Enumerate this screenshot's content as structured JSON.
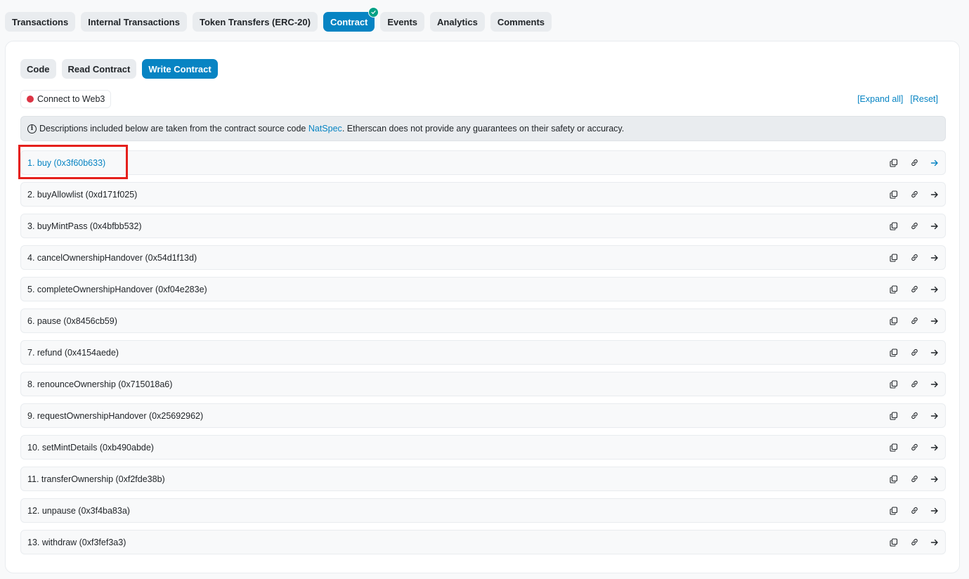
{
  "tabs": [
    {
      "label": "Transactions"
    },
    {
      "label": "Internal Transactions"
    },
    {
      "label": "Token Transfers (ERC-20)"
    },
    {
      "label": "Contract"
    },
    {
      "label": "Events"
    },
    {
      "label": "Analytics"
    },
    {
      "label": "Comments"
    }
  ],
  "subtabs": [
    {
      "label": "Code"
    },
    {
      "label": "Read Contract"
    },
    {
      "label": "Write Contract"
    }
  ],
  "connect": {
    "label": "Connect to Web3"
  },
  "links": {
    "expand_all": "[Expand all]",
    "reset": "[Reset]"
  },
  "notice": {
    "prefix": "Descriptions included below are taken from the contract source code",
    "link": "NatSpec",
    "suffix": ". Etherscan does not provide any guarantees on their safety or accuracy."
  },
  "functions": [
    "1. buy (0x3f60b633)",
    "2. buyAllowlist (0xd171f025)",
    "3. buyMintPass (0x4bfbb532)",
    "4. cancelOwnershipHandover (0x54d1f13d)",
    "5. completeOwnershipHandover (0xf04e283e)",
    "6. pause (0x8456cb59)",
    "7. refund (0x4154aede)",
    "8. renounceOwnership (0x715018a6)",
    "9. requestOwnershipHandover (0x25692962)",
    "10. setMintDetails (0xb490abde)",
    "11. transferOwnership (0xf2fde38b)",
    "12. unpause (0x3f4ba83a)",
    "13. withdraw (0xf3fef3a3)"
  ],
  "colors": {
    "accent": "#0784c3",
    "verified": "#00a186",
    "disconnected": "#dc3545",
    "highlight": "#e5201c"
  }
}
